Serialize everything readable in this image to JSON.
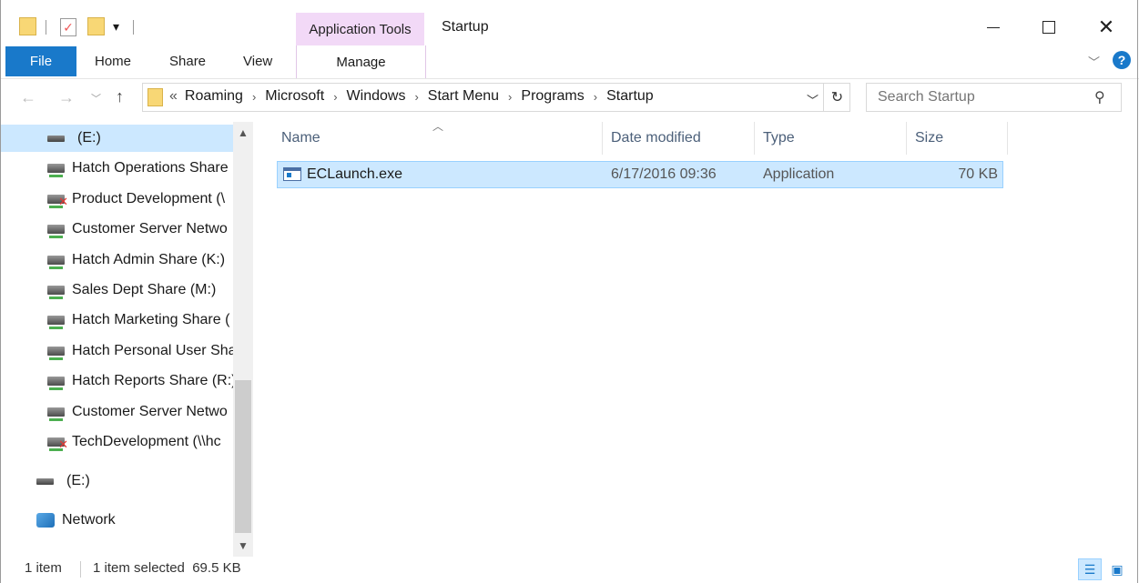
{
  "window": {
    "title": "Startup",
    "context_tab": "Application Tools",
    "quick_access_dropdown": "▾"
  },
  "ribbon": {
    "tabs": [
      "File",
      "Home",
      "Share",
      "View"
    ],
    "context_subtab": "Manage"
  },
  "address": {
    "overflow": "«",
    "breadcrumbs": [
      "Roaming",
      "Microsoft",
      "Windows",
      "Start Menu",
      "Programs",
      "Startup"
    ],
    "search_placeholder": "Search Startup"
  },
  "nav_pane": {
    "items": [
      {
        "label": "(E:)",
        "kind": "local",
        "selected": true
      },
      {
        "label": "Hatch Operations Share",
        "kind": "net"
      },
      {
        "label": "Product Development (\\",
        "kind": "net-error"
      },
      {
        "label": "Customer Server Netwo",
        "kind": "net"
      },
      {
        "label": "Hatch Admin Share (K:)",
        "kind": "net"
      },
      {
        "label": "Sales Dept Share (M:)",
        "kind": "net"
      },
      {
        "label": "Hatch Marketing Share (",
        "kind": "net"
      },
      {
        "label": "Hatch Personal User Sha",
        "kind": "net"
      },
      {
        "label": "Hatch Reports Share (R:)",
        "kind": "net"
      },
      {
        "label": "Customer Server Netwo",
        "kind": "net"
      },
      {
        "label": "TechDevelopment (\\\\hc",
        "kind": "net-error"
      }
    ],
    "root_items": [
      {
        "label": "(E:)",
        "kind": "local"
      },
      {
        "label": "Network",
        "kind": "network"
      }
    ]
  },
  "file_list": {
    "columns": [
      "Name",
      "Date modified",
      "Type",
      "Size"
    ],
    "rows": [
      {
        "name": "ECLaunch.exe",
        "date": "6/17/2016 09:36",
        "type": "Application",
        "size": "70 KB"
      }
    ]
  },
  "status": {
    "count": "1 item",
    "selection": "1 item selected  69.5 KB"
  },
  "colors": {
    "accent": "#1979ca",
    "selection": "#cce8ff",
    "context_tab": "#f2d9f7"
  }
}
